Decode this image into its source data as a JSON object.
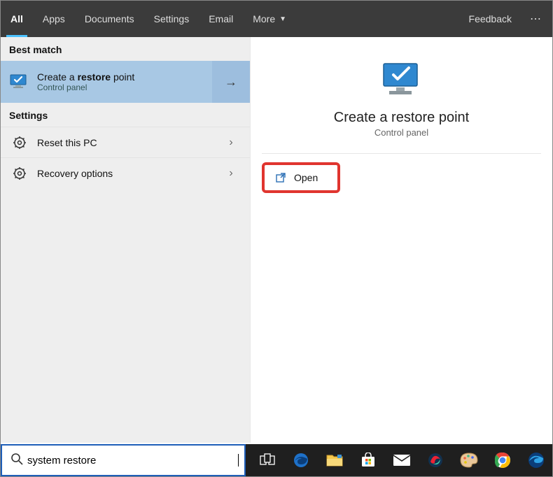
{
  "topbar": {
    "tabs": [
      "All",
      "Apps",
      "Documents",
      "Settings",
      "Email"
    ],
    "more_label": "More",
    "feedback_label": "Feedback"
  },
  "left": {
    "best_match_label": "Best match",
    "best_match": {
      "title_pre": "Create a ",
      "title_bold": "restore",
      "title_post": " point",
      "subtitle": "Control panel"
    },
    "settings_label": "Settings",
    "settings_items": [
      {
        "label": "Reset this PC"
      },
      {
        "label": "Recovery options"
      }
    ]
  },
  "detail": {
    "title": "Create a restore point",
    "subtitle": "Control panel",
    "open_label": "Open"
  },
  "search": {
    "value": "system restore"
  },
  "taskbar_icons": [
    "task-view",
    "edge",
    "file-explorer",
    "microsoft-store",
    "mail",
    "photos-swirl",
    "paint-palette",
    "chrome",
    "edge-classic"
  ]
}
